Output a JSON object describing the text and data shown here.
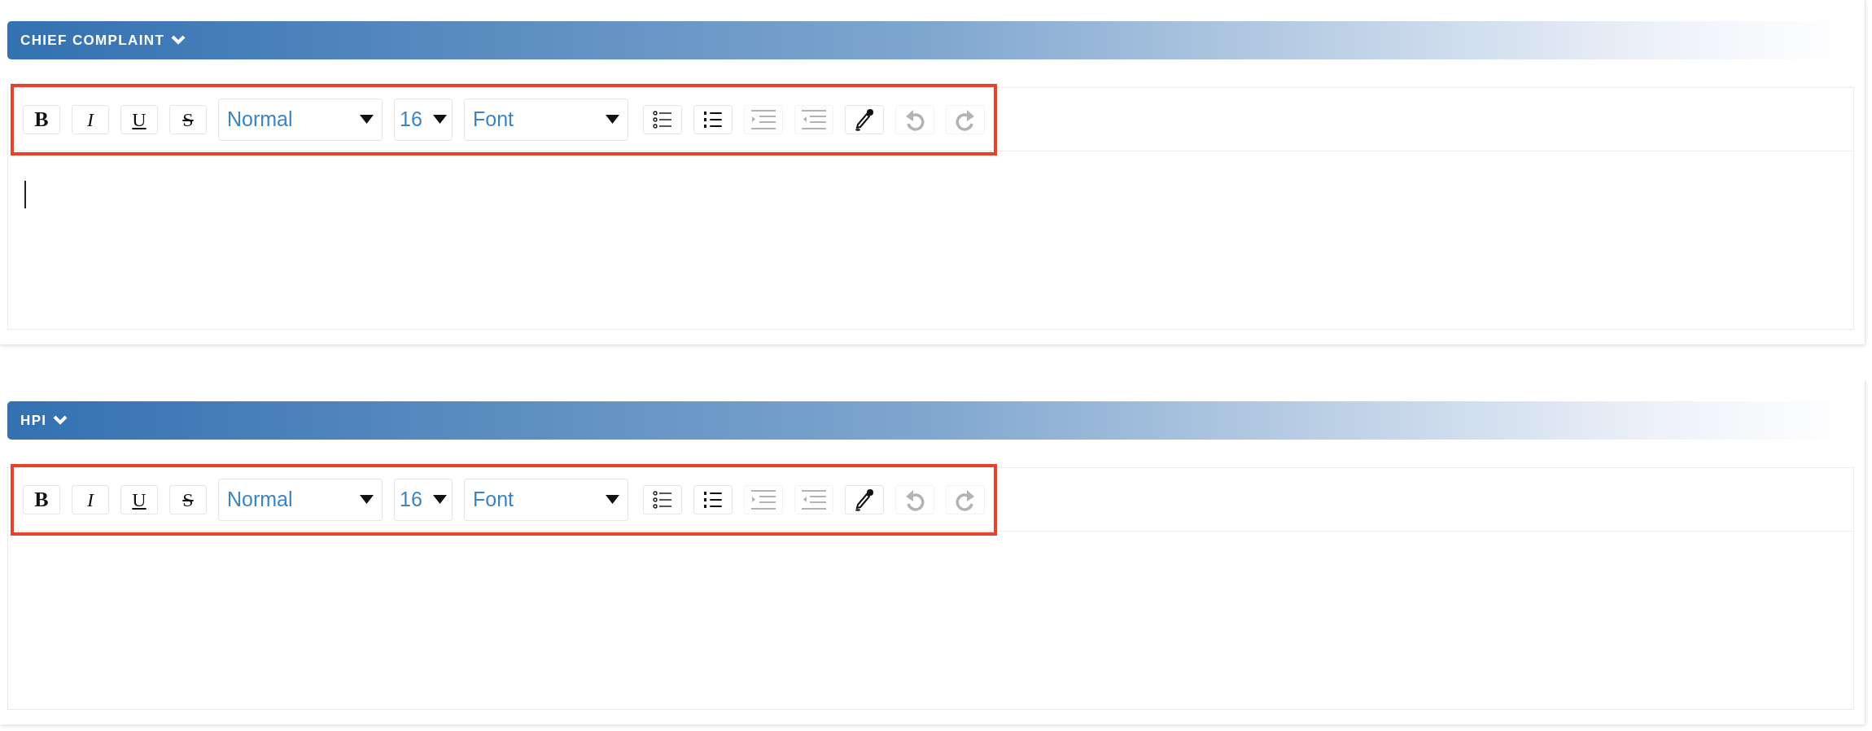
{
  "sections": [
    {
      "title": "CHIEF COMPLAINT",
      "expanded": true,
      "toolbar": {
        "highlighted": true,
        "items": [
          {
            "kind": "bold",
            "label": "B",
            "disabled": false
          },
          {
            "kind": "italic",
            "label": "I",
            "disabled": false
          },
          {
            "kind": "underline",
            "label": "U",
            "disabled": false
          },
          {
            "kind": "strike",
            "label": "S",
            "disabled": false
          },
          {
            "kind": "select",
            "value": "Normal"
          },
          {
            "kind": "size-select",
            "value": "16"
          },
          {
            "kind": "select",
            "value": "Font"
          },
          {
            "kind": "bullet-list",
            "disabled": false
          },
          {
            "kind": "numbered-list",
            "disabled": false
          },
          {
            "kind": "indent",
            "disabled": true
          },
          {
            "kind": "outdent",
            "disabled": true
          },
          {
            "kind": "color-picker",
            "disabled": false
          },
          {
            "kind": "undo",
            "disabled": true
          },
          {
            "kind": "redo",
            "disabled": true
          }
        ]
      },
      "editor": {
        "focused": true
      }
    },
    {
      "title": "HPI",
      "expanded": true,
      "toolbar": {
        "highlighted": true,
        "items": [
          {
            "kind": "bold",
            "label": "B",
            "disabled": false
          },
          {
            "kind": "italic",
            "label": "I",
            "disabled": false
          },
          {
            "kind": "underline",
            "label": "U",
            "disabled": false
          },
          {
            "kind": "strike",
            "label": "S",
            "disabled": false
          },
          {
            "kind": "select",
            "value": "Normal"
          },
          {
            "kind": "size-select",
            "value": "16"
          },
          {
            "kind": "select",
            "value": "Font"
          },
          {
            "kind": "bullet-list",
            "disabled": false
          },
          {
            "kind": "numbered-list",
            "disabled": false
          },
          {
            "kind": "indent",
            "disabled": true
          },
          {
            "kind": "outdent",
            "disabled": true
          },
          {
            "kind": "color-picker",
            "disabled": false
          },
          {
            "kind": "undo",
            "disabled": true
          },
          {
            "kind": "redo",
            "disabled": true
          }
        ]
      },
      "editor": {
        "focused": false
      }
    }
  ]
}
